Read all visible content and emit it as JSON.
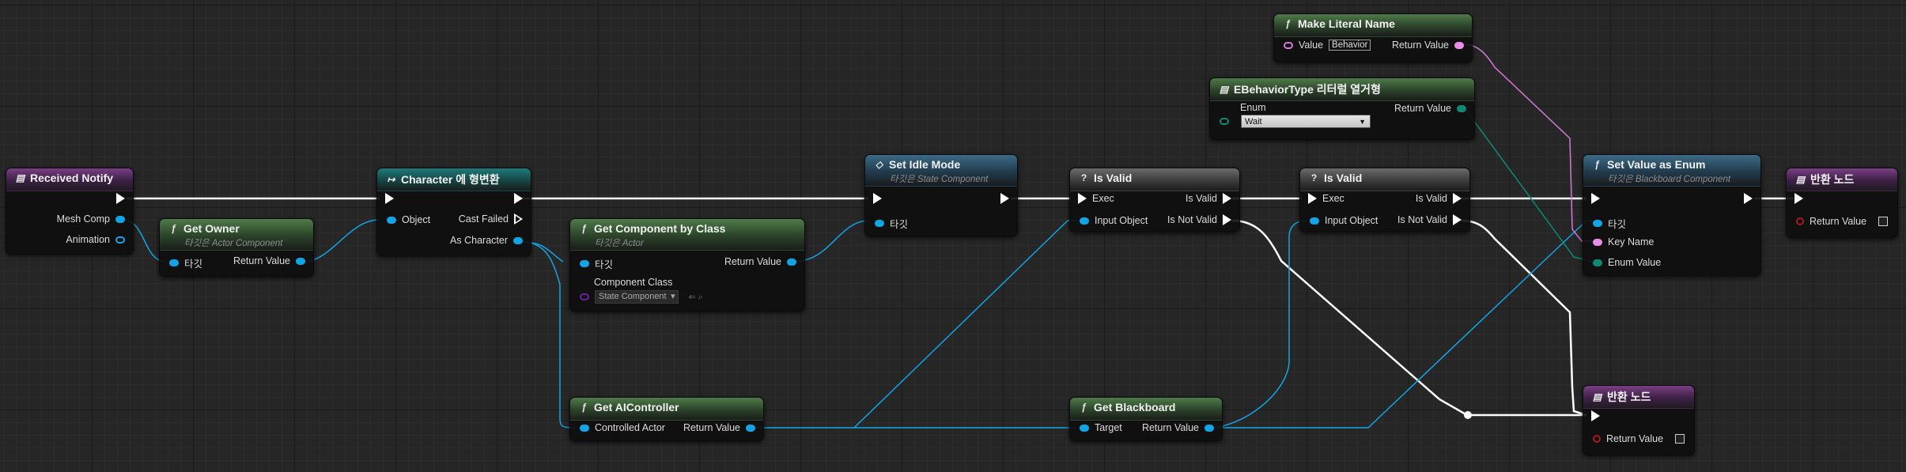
{
  "nodes": {
    "received_notify": {
      "title": "Received Notify",
      "pins": {
        "mesh_comp": "Mesh Comp",
        "animation": "Animation"
      }
    },
    "get_owner": {
      "title": "Get Owner",
      "subtitle": "타깃은 Actor Component",
      "pins": {
        "target": "타깃",
        "return_value": "Return Value"
      }
    },
    "cast_character": {
      "title": "Character 에 형변환",
      "pins": {
        "object": "Object",
        "cast_failed": "Cast Failed",
        "as_character": "As Character"
      }
    },
    "get_component_by_class": {
      "title": "Get Component by Class",
      "subtitle": "타깃은 Actor",
      "pins": {
        "target": "타깃",
        "return_value": "Return Value",
        "component_class": "Component Class",
        "component_class_value": "State Component"
      }
    },
    "set_idle_mode": {
      "title": "Set Idle Mode",
      "subtitle": "타깃은 State Component",
      "pins": {
        "target": "타깃"
      }
    },
    "is_valid_1": {
      "title": "Is Valid",
      "pins": {
        "exec": "Exec",
        "is_valid": "Is Valid",
        "input_object": "Input Object",
        "is_not_valid": "Is Not Valid"
      }
    },
    "is_valid_2": {
      "title": "Is Valid",
      "pins": {
        "exec": "Exec",
        "is_valid": "Is Valid",
        "input_object": "Input Object",
        "is_not_valid": "Is Not Valid"
      }
    },
    "make_literal_name": {
      "title": "Make Literal Name",
      "pins": {
        "value": "Value",
        "value_text": "Behavior",
        "return_value": "Return Value"
      }
    },
    "ebehaviortype_literal": {
      "title": "EBehaviorType 리터럴 열거형",
      "pins": {
        "enum": "Enum",
        "enum_value": "Wait",
        "return_value": "Return Value"
      }
    },
    "set_value_as_enum": {
      "title": "Set Value as Enum",
      "subtitle": "타깃은 Blackboard Component",
      "pins": {
        "target": "타깃",
        "key_name": "Key Name",
        "enum_value": "Enum Value"
      }
    },
    "return_node_1": {
      "title": "반환 노드",
      "pins": {
        "return_value": "Return Value"
      }
    },
    "return_node_2": {
      "title": "반환 노드",
      "pins": {
        "return_value": "Return Value"
      }
    },
    "get_aicontroller": {
      "title": "Get AIController",
      "pins": {
        "controlled_actor": "Controlled Actor",
        "return_value": "Return Value"
      }
    },
    "get_blackboard": {
      "title": "Get Blackboard",
      "pins": {
        "target": "Target",
        "return_value": "Return Value"
      }
    }
  },
  "colors": {
    "exec_wire": "#ffffff",
    "object_wire": "#11a5e6",
    "name_wire": "#d279d6",
    "enum_wire": "#0c8a73",
    "event_header": "#7a3f86",
    "pure_header": "#4f7a4a",
    "function_header": "#3c6a86"
  }
}
